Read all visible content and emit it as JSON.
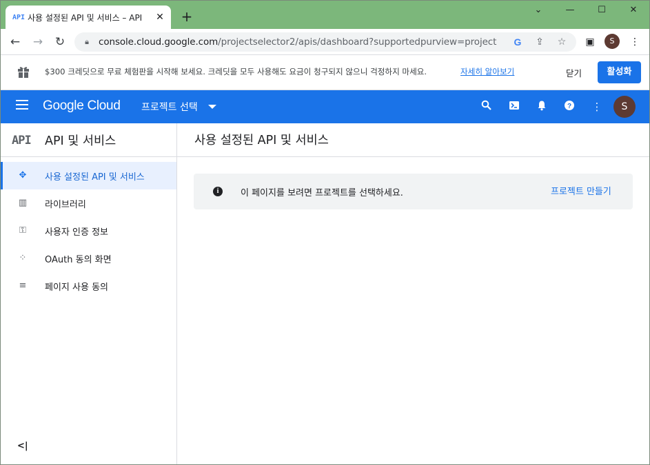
{
  "browser": {
    "tab_favicon": "API",
    "tab_title": "사용 설정된 API 및 서비스 – API",
    "url_host": "console.cloud.google.com",
    "url_path": "/projectselector2/apis/dashboard?supportedpurview=project",
    "profile_initial": "S",
    "icons": [
      "back-icon",
      "forward-icon",
      "reload-icon",
      "lock-icon",
      "google-icon",
      "share-icon",
      "star-icon",
      "side-panel-icon",
      "more-vert-icon"
    ]
  },
  "banner": {
    "text": "$300 크레딧으로 무료 체험판을 시작해 보세요. 크레딧을 모두 사용해도 요금이 청구되지 않으니 걱정하지 마세요.",
    "link": "자세히 알아보기",
    "close_label": "닫기",
    "activate_label": "활성화"
  },
  "header": {
    "logo": "Google Cloud",
    "project_select": "프로젝트 선택",
    "avatar_initial": "S",
    "icons": [
      "search-icon",
      "terminal-icon",
      "bell-icon",
      "help-icon",
      "more-vert-icon"
    ]
  },
  "sidebar": {
    "title_icon": "API",
    "title": "API 및 서비스",
    "items": [
      {
        "label": "사용 설정된 API 및 서비스",
        "icon": "enabled-apis-icon"
      },
      {
        "label": "라이브러리",
        "icon": "library-icon"
      },
      {
        "label": "사용자 인증 정보",
        "icon": "key-icon"
      },
      {
        "label": "OAuth 동의 화면",
        "icon": "oauth-icon"
      },
      {
        "label": "페이지 사용 동의",
        "icon": "page-usage-icon"
      }
    ],
    "collapse_label": "<|"
  },
  "main": {
    "title": "사용 설정된 API 및 서비스",
    "info_text": "이 페이지를 보려면 프로젝트를 선택하세요.",
    "info_link": "프로젝트 만들기"
  },
  "colors": {
    "brand_blue": "#1a73e8",
    "tab_strip": "#7cb77b",
    "active_nav_bg": "#e8f0fe"
  }
}
